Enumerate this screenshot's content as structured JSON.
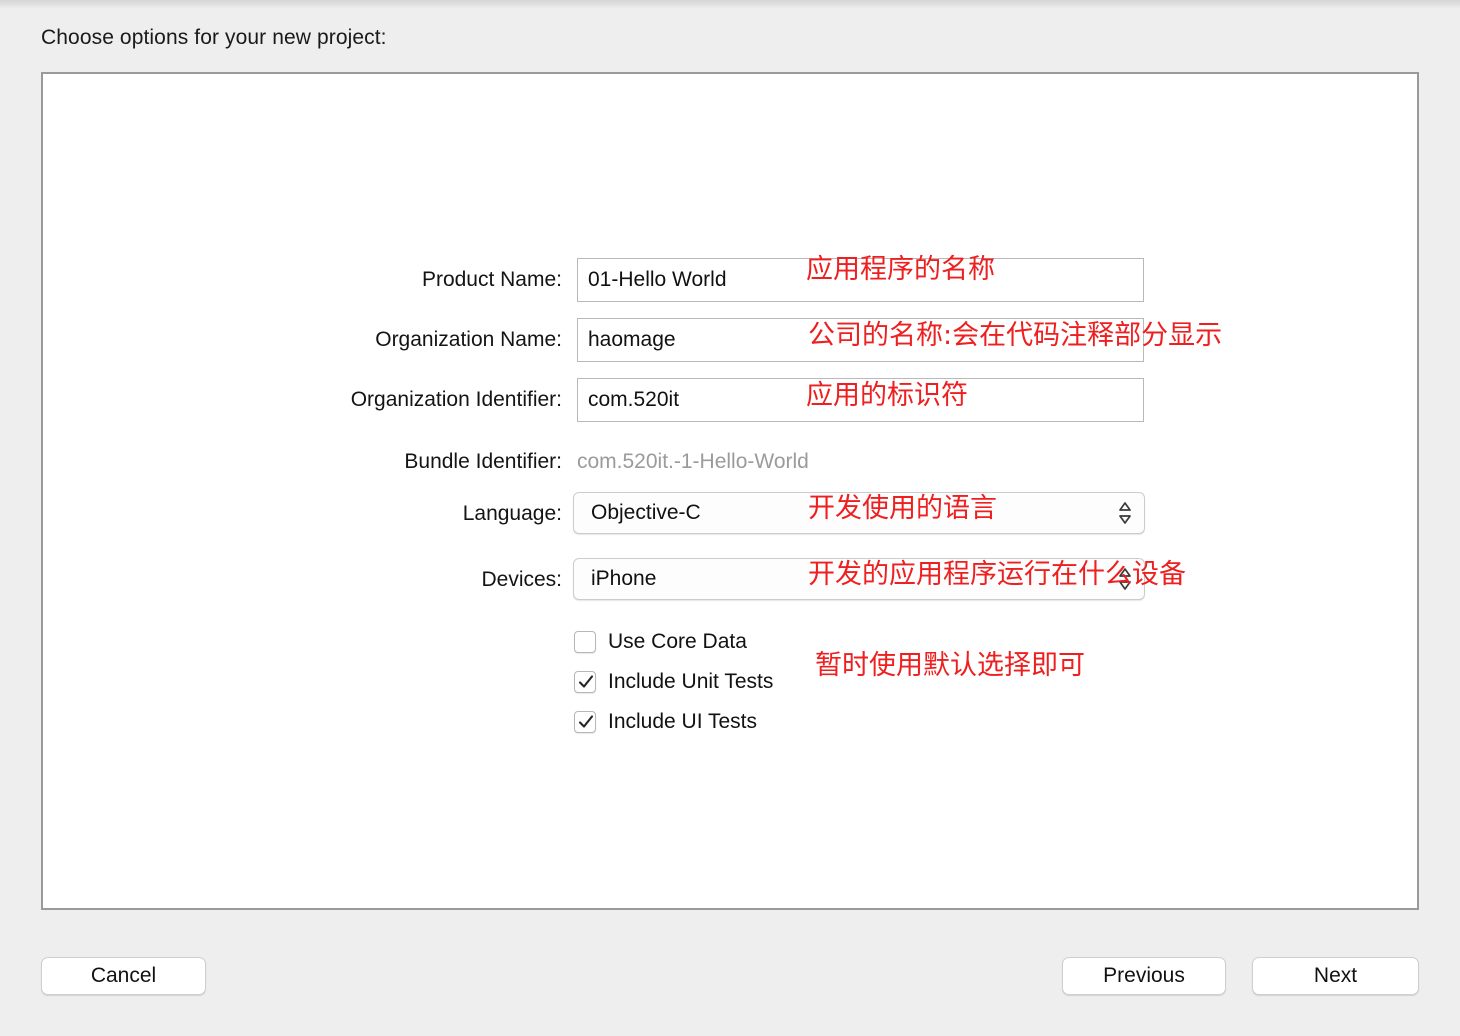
{
  "window": {
    "title": "Choose options for your new project:"
  },
  "form": {
    "rows": [
      {
        "label": "Product Name:",
        "value": "01-Hello World",
        "type": "textfield"
      },
      {
        "label": "Organization Name:",
        "value": "haomage",
        "type": "textfield"
      },
      {
        "label": "Organization Identifier:",
        "value": "com.520it",
        "type": "textfield"
      },
      {
        "label": "Bundle Identifier:",
        "value": "com.520it.-1-Hello-World",
        "type": "static"
      },
      {
        "label": "Language:",
        "value": "Objective-C",
        "type": "popup"
      },
      {
        "label": "Devices:",
        "value": "iPhone",
        "type": "popup"
      }
    ]
  },
  "checkboxes": [
    {
      "label": "Use Core Data",
      "checked": false
    },
    {
      "label": "Include Unit Tests",
      "checked": true
    },
    {
      "label": "Include UI Tests",
      "checked": true
    }
  ],
  "annotations": [
    {
      "text": "应用程序的名称"
    },
    {
      "text": "公司的名称:会在代码注释部分显示"
    },
    {
      "text": "应用的标识符"
    },
    {
      "text": "开发使用的语言"
    },
    {
      "text": "开发的应用程序运行在什么设备"
    },
    {
      "text": "暂时使用默认选择即可"
    }
  ],
  "buttons": {
    "cancel": "Cancel",
    "previous": "Previous",
    "next": "Next"
  },
  "colors": {
    "annotation_red": "#ee1f1f",
    "panel_border": "#9a9a9a",
    "background": "#eeeeee",
    "static_text": "#9b9b9b"
  }
}
